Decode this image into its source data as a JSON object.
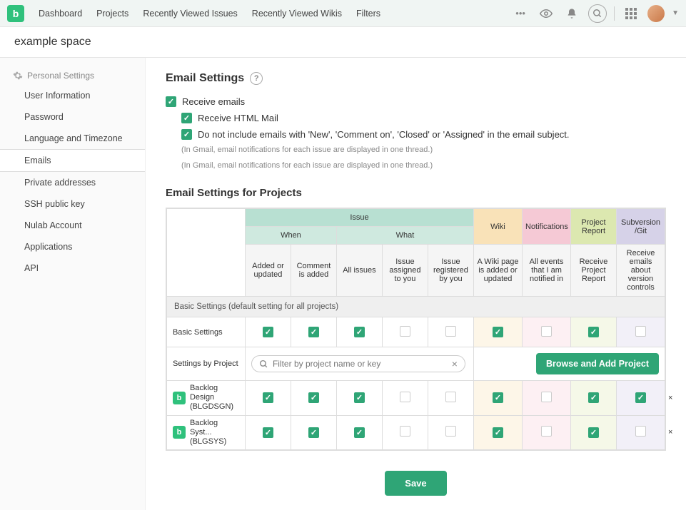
{
  "topnav": [
    "Dashboard",
    "Projects",
    "Recently Viewed Issues",
    "Recently Viewed Wikis",
    "Filters"
  ],
  "space_name": "example space",
  "side_head": "Personal Settings",
  "side_items": [
    "User Information",
    "Password",
    "Language and Timezone",
    "Emails",
    "Private addresses",
    "SSH public key",
    "Nulab Account",
    "Applications",
    "API"
  ],
  "side_active": 3,
  "page_title": "Email Settings",
  "opts": {
    "receive": "Receive emails",
    "html": "Receive HTML Mail",
    "subject": "Do not include emails with 'New', 'Comment on', 'Closed' or 'Assigned' in the email subject.",
    "note": "(In Gmail, email notifications for each issue are displayed in one thread.)"
  },
  "section2_title": "Email Settings for Projects",
  "thead": {
    "issue": "Issue",
    "when": "When",
    "what": "What",
    "wiki": "Wiki",
    "notif": "Notifications",
    "report": "Project Report",
    "svn": "Subversion /Git",
    "cols": [
      "Added or updated",
      "Comment is added",
      "All issues",
      "Issue assigned to you",
      "Issue registered by you",
      "A Wiki page is added or updated",
      "All events that I am notified in",
      "Receive Project Report",
      "Receive emails about version controls"
    ]
  },
  "basic_hdr": "Basic Settings (default setting for all projects)",
  "basic_label": "Basic Settings",
  "basic_vals": [
    true,
    true,
    true,
    false,
    false,
    true,
    false,
    true,
    false
  ],
  "byproj_label": "Settings by Project",
  "filter_placeholder": "Filter by project name or key",
  "add_btn": "Browse and Add Project",
  "projects": [
    {
      "name": "Backlog Design (BLGDSGN)",
      "vals": [
        true,
        true,
        true,
        false,
        false,
        true,
        false,
        true,
        true
      ]
    },
    {
      "name": "Backlog Syst... (BLGSYS)",
      "vals": [
        true,
        true,
        true,
        false,
        false,
        true,
        false,
        true,
        false
      ]
    }
  ],
  "save": "Save"
}
